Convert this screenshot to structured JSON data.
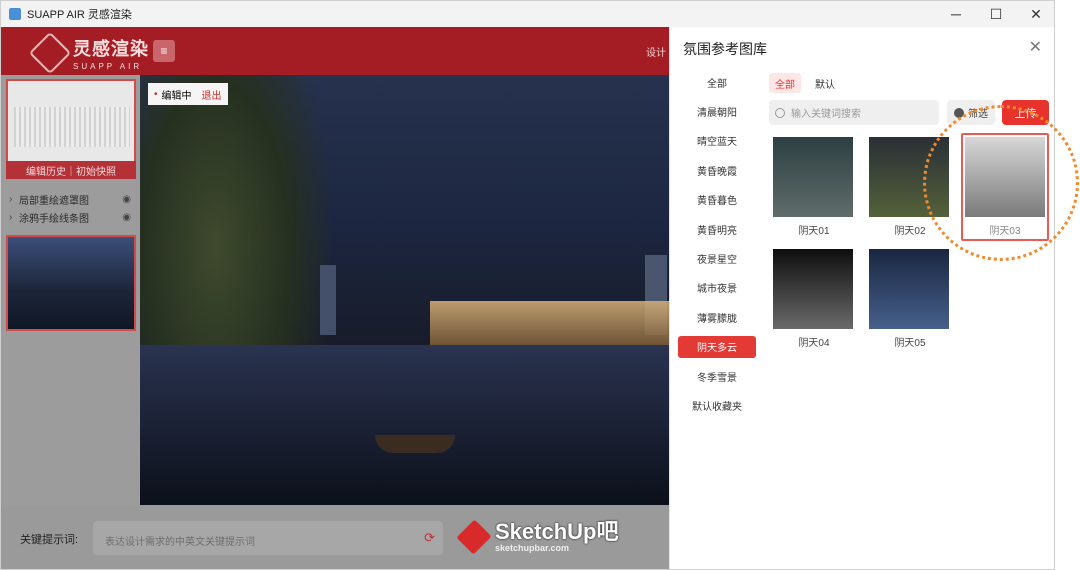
{
  "window": {
    "title": "SUAPP AIR 灵感渲染",
    "controls": {
      "minimize": "─",
      "maximize": "☐",
      "close": "✕"
    }
  },
  "header": {
    "logo_cn": "灵感渲染",
    "logo_en": "SUAPP AIR",
    "menu_icon": "≡",
    "design_label": "设计"
  },
  "left_panel": {
    "history_label": "编辑历史｜初始快照",
    "layers": [
      {
        "label": "局部重绘遮罩图"
      },
      {
        "label": "涂鸦手绘线条图"
      }
    ],
    "eye_icon": "◉",
    "chevron": "›"
  },
  "canvas": {
    "edit_status": "编辑中",
    "exit_label": "退出",
    "dot": "•"
  },
  "prompt": {
    "label": "关键提示词:",
    "placeholder": "表达设计需求的中英文关键提示词",
    "icon": "⟳"
  },
  "watermark": {
    "main": "SketchUp吧",
    "sub": "sketchupbar.com"
  },
  "drawer": {
    "title": "氛围参考图库",
    "close_icon": "✕",
    "categories": [
      {
        "label": "全部",
        "active": false
      },
      {
        "label": "清晨朝阳",
        "active": false
      },
      {
        "label": "晴空蓝天",
        "active": false
      },
      {
        "label": "黄昏晚霞",
        "active": false
      },
      {
        "label": "黄昏暮色",
        "active": false
      },
      {
        "label": "黄昏明亮",
        "active": false
      },
      {
        "label": "夜景星空",
        "active": false
      },
      {
        "label": "城市夜景",
        "active": false
      },
      {
        "label": "薄雾朦胧",
        "active": false
      },
      {
        "label": "阴天多云",
        "active": true
      },
      {
        "label": "冬季雪景",
        "active": false
      },
      {
        "label": "默认收藏夹",
        "active": false
      }
    ],
    "tabs": [
      {
        "label": "全部",
        "active": true
      },
      {
        "label": "默认",
        "active": false
      }
    ],
    "search_placeholder": "输入关键词搜索",
    "filter_label": "筛选",
    "upload_label": "上传",
    "images": [
      {
        "label": "阴天01",
        "selected": false,
        "colors": [
          "#2d3f42",
          "#5f6d6a"
        ]
      },
      {
        "label": "阴天02",
        "selected": false,
        "colors": [
          "#2b2f36",
          "#54613a"
        ]
      },
      {
        "label": "阴天03",
        "selected": true,
        "colors": [
          "#d7d7d7",
          "#7a7a7a"
        ]
      },
      {
        "label": "阴天04",
        "selected": false,
        "colors": [
          "#0e0e0e",
          "#6a6a6a"
        ]
      },
      {
        "label": "阴天05",
        "selected": false,
        "colors": [
          "#1a2640",
          "#46608c"
        ]
      }
    ]
  }
}
